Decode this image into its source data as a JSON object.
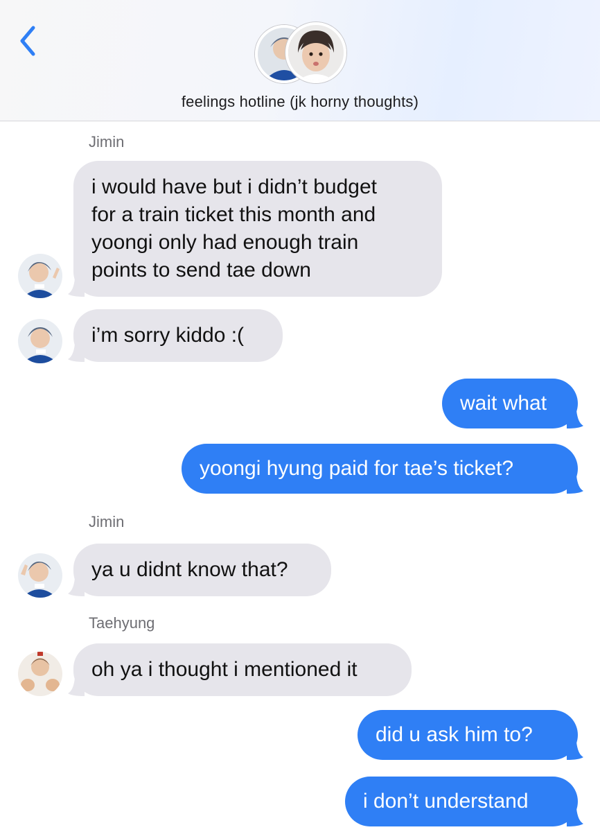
{
  "header": {
    "title": "feelings hotline (jk horny thoughts)",
    "back_icon": "chevron-left-icon",
    "accent_color": "#2f7ff5"
  },
  "messages": [
    {
      "sender": "Jimin",
      "text_lines": [
        "i would have but i didn’t budget",
        "for a train ticket this month and",
        "yoongi only had enough train",
        "points to send tae down"
      ],
      "direction": "incoming"
    },
    {
      "sender": "Jimin",
      "text": "i’m sorry kiddo :(",
      "direction": "incoming"
    },
    {
      "sender": "me",
      "text": "wait what",
      "direction": "outgoing"
    },
    {
      "sender": "me",
      "text": "yoongi hyung paid for tae’s ticket?",
      "direction": "outgoing"
    },
    {
      "sender": "Jimin",
      "text": "ya u didnt know that?",
      "direction": "incoming"
    },
    {
      "sender": "Taehyung",
      "text": "oh ya i thought i mentioned it",
      "direction": "incoming"
    },
    {
      "sender": "me",
      "text": "did u ask him to?",
      "direction": "outgoing"
    },
    {
      "sender": "me",
      "text": "i don’t understand",
      "direction": "outgoing"
    }
  ],
  "sender_labels": {
    "jimin_1": "Jimin",
    "jimin_2": "Jimin",
    "taehyung": "Taehyung"
  },
  "colors": {
    "incoming_bubble": "#e6e5eb",
    "outgoing_bubble": "#2f7ff5"
  }
}
